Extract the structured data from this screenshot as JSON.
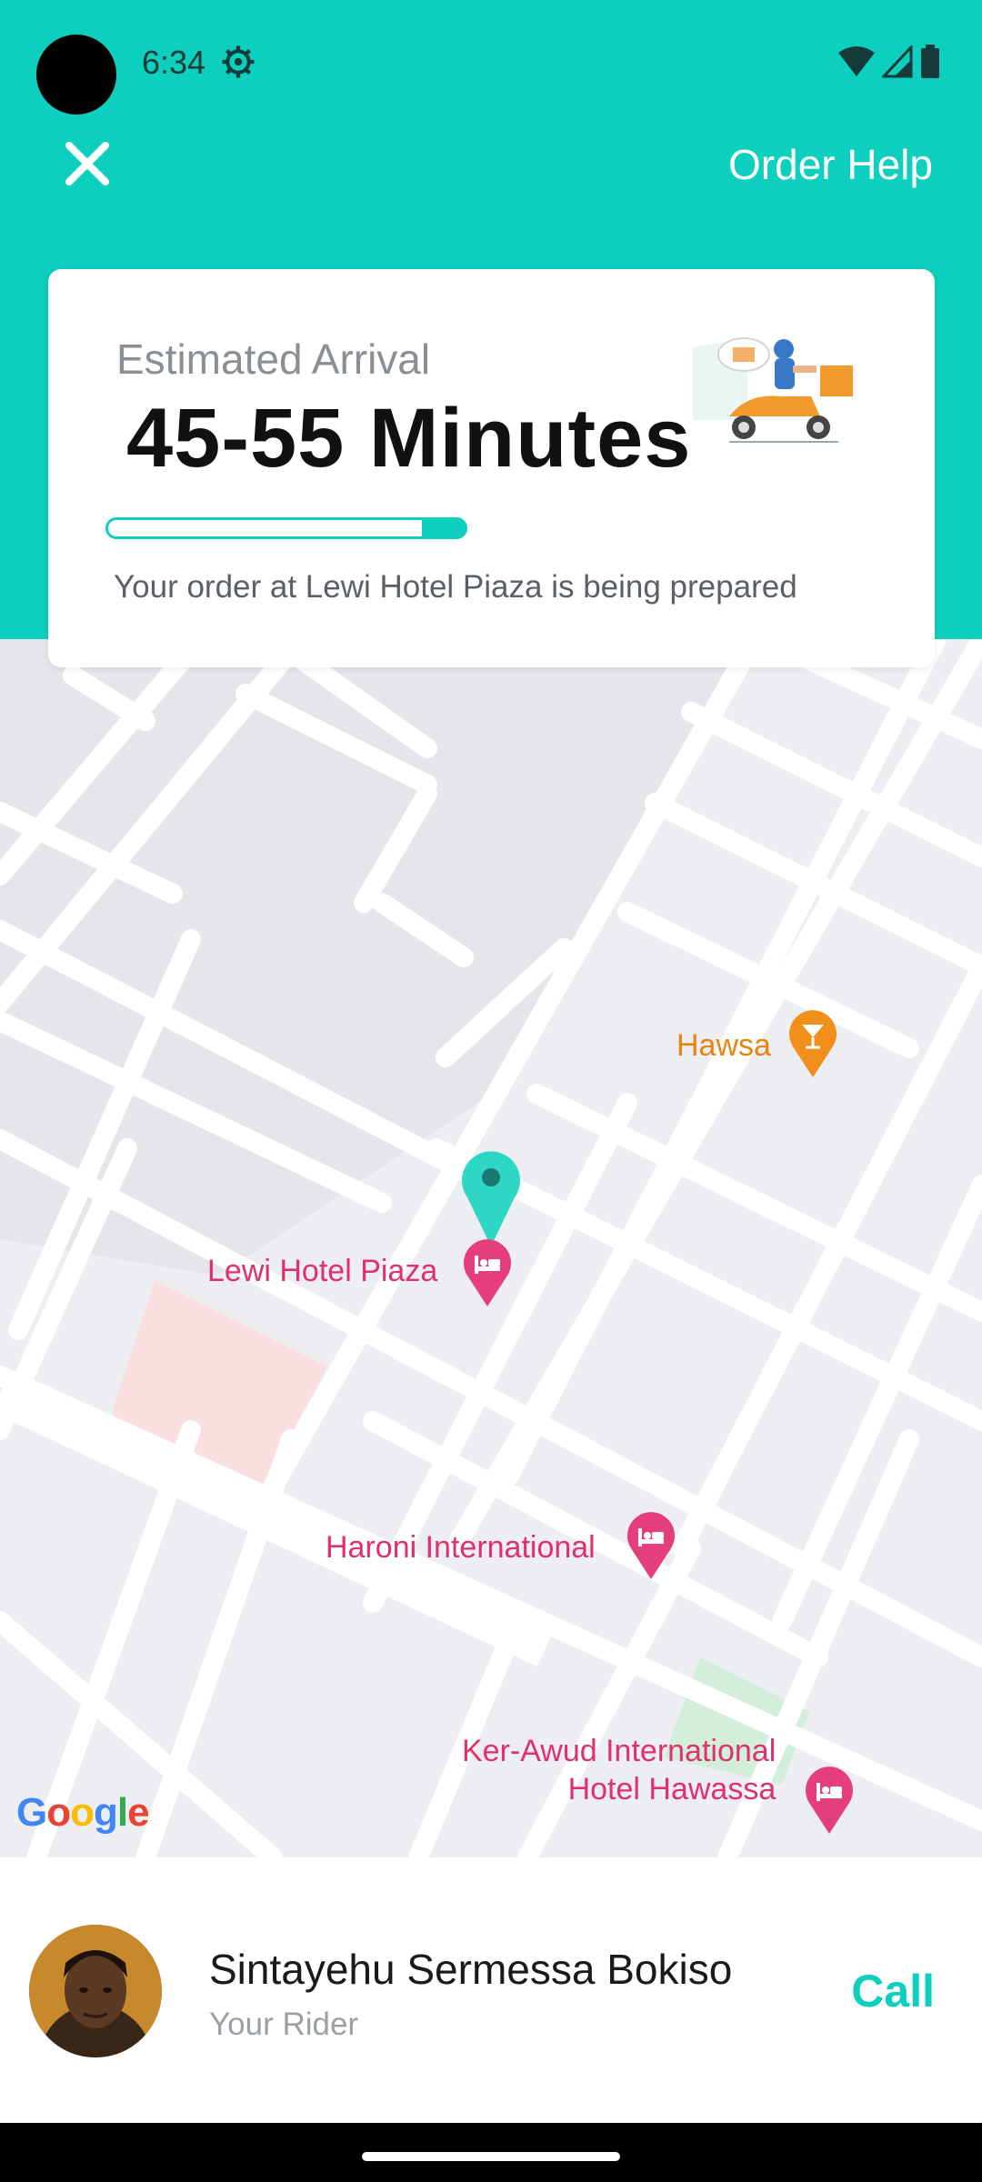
{
  "status_bar": {
    "time": "6:34"
  },
  "top_bar": {
    "order_help_label": "Order Help"
  },
  "eta_card": {
    "label": "Estimated Arrival",
    "value": "45-55 Minutes",
    "progress_fraction": 0.12,
    "message": "Your order at Lewi Hotel Piaza is being prepared"
  },
  "map": {
    "pois": [
      {
        "name": "Hawsa",
        "color": "#e8840f",
        "icon": "bar-icon"
      },
      {
        "name": "Lewi Hotel Piaza",
        "color": "#e0306e",
        "icon": "hotel-icon"
      },
      {
        "name": "Haroni International",
        "color": "#e0306e",
        "icon": "hotel-icon"
      },
      {
        "name": "Ker-Awud International",
        "name_line2": "Hotel Hawassa",
        "color": "#e0306e",
        "icon": "hotel-icon"
      }
    ],
    "attribution": "Google",
    "pin_color": "#2ed6c4"
  },
  "rider": {
    "name": "Sintayehu Sermessa Bokiso",
    "role": "Your Rider",
    "call_label": "Call"
  },
  "colors": {
    "accent": "#0ccfbd",
    "hotel_poi": "#e0306e",
    "bar_poi": "#e8840f"
  }
}
